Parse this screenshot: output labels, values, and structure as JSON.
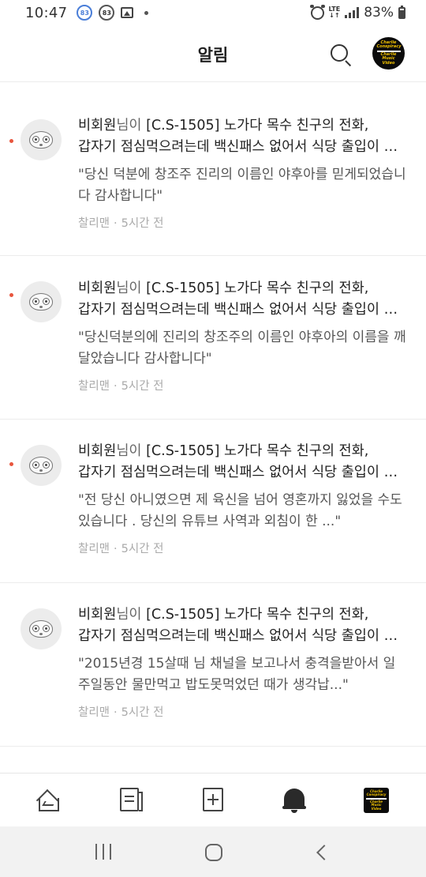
{
  "status_bar": {
    "time": "10:47",
    "badge1": "83",
    "badge2": "83",
    "network": "LTE",
    "battery": "83%"
  },
  "header": {
    "title": "알림"
  },
  "channel_logo": {
    "line1": "Charlie",
    "line2": "Conspiracy",
    "line3": "Charlie",
    "line4": "Music Video"
  },
  "notifications": [
    {
      "unread": true,
      "actor": "비회원",
      "actor_suffix": "님이",
      "title_line1": " [C.S-1505] 노가다 목수 친구의 전화,",
      "title_line2": "갑자기 점심먹으려는데 백신패스 없어서 식당 출입이 거절되었다",
      "comment": "\"당신 덕분에 창조주 진리의 이름인 야후아를 믿게되었습니다 감사합니다\"",
      "author": "찰리맨",
      "time": "5시간 전"
    },
    {
      "unread": true,
      "actor": "비회원",
      "actor_suffix": "님이",
      "title_line1": " [C.S-1505] 노가다 목수 친구의 전화,",
      "title_line2": "갑자기 점심먹으려는데 백신패스 없어서 식당 출입이 거절되었다",
      "comment": "\"당신덕분의에 진리의 창조주의 이름인 야후아의 이름을 깨달았습니다 감사합니다\"",
      "author": "찰리맨",
      "time": "5시간 전"
    },
    {
      "unread": true,
      "actor": "비회원",
      "actor_suffix": "님이",
      "title_line1": " [C.S-1505] 노가다 목수 친구의 전화,",
      "title_line2": "갑자기 점심먹으려는데 백신패스 없어서 식당 출입이 거절되었다",
      "comment": "\"전 당신 아니였으면 제 육신을 넘어 영혼까지 잃었을 수도 있습니다 . 당신의 유튜브 사역과 외침이 한 ...\"",
      "author": "찰리맨",
      "time": "5시간 전"
    },
    {
      "unread": false,
      "actor": "비회원",
      "actor_suffix": "님이",
      "title_line1": " [C.S-1505] 노가다 목수 친구의 전화,",
      "title_line2": "갑자기 점심먹으려는데 백신패스 없어서 식당 출입이 거절되었다",
      "comment": "\"2015년경 15살때 님 채널을 보고나서 충격을받아서 일주일동안 물만먹고 밥도못먹었던 때가 생각납...\"",
      "author": "찰리맨",
      "time": "5시간 전"
    }
  ],
  "bottom_nav": {
    "items": [
      "home-icon",
      "posts-icon",
      "write-icon",
      "bell-icon",
      "channel-icon"
    ],
    "active": "bell-icon"
  },
  "colors": {
    "unread_dot": "#e8553d",
    "logo_yellow": "#f0c000"
  }
}
